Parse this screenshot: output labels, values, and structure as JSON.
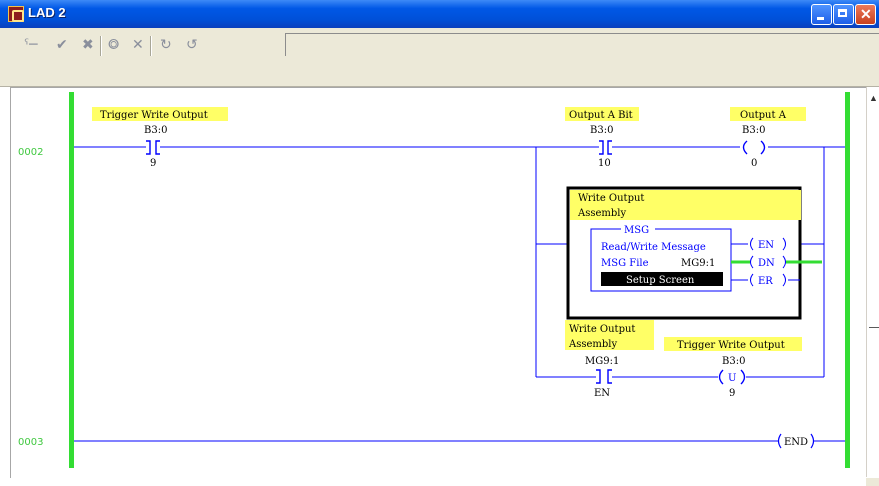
{
  "window": {
    "title": "LAD 2"
  },
  "toolbar": {
    "icons": [
      "insert-rung-icon",
      "accept-edits-icon",
      "cancel-edits-icon",
      "test-edits-icon",
      "delete-icon",
      "assemble-icon",
      "cancel-assemble-icon"
    ]
  },
  "rung1": {
    "number": "0002",
    "trigger_contact": {
      "desc": "Trigger Write Output",
      "address": "B3:0",
      "bit": "9"
    },
    "output_bit_contact": {
      "desc": "Output A Bit",
      "address": "B3:0",
      "bit": "10"
    },
    "output_coil": {
      "desc": "Output A",
      "address": "B3:0",
      "bit": "0"
    },
    "msg_block": {
      "desc_line1": "Write Output",
      "desc_line2": "Assembly",
      "title": "MSG",
      "label": "Read/Write Message",
      "file_label": "MSG File",
      "file_value": "MG9:1",
      "setup_button": "Setup Screen",
      "outputs": [
        "EN",
        "DN",
        "ER"
      ]
    },
    "msg_enable_contact": {
      "desc_line1": "Write Output",
      "desc_line2": "Assembly",
      "address": "MG9:1",
      "bit": "EN"
    },
    "unlatch_coil": {
      "desc": "Trigger Write Output",
      "address": "B3:0",
      "symbol": "U",
      "bit": "9"
    }
  },
  "rung2": {
    "number": "0003",
    "end_label": "END"
  },
  "colors": {
    "rail": "#33dd33",
    "wire": "#0000ff",
    "label_bg": "#ffff66",
    "energized": "#33dd33"
  }
}
